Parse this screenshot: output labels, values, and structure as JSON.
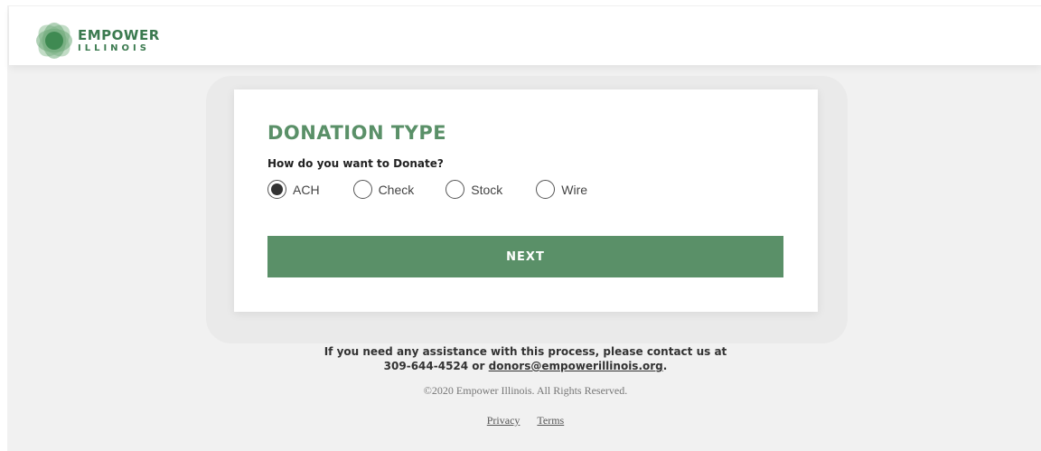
{
  "brand": {
    "logo_line1": "EMPOWER",
    "logo_line2": "ILLINOIS",
    "logo_icon": "leaf-flower-icon",
    "primary_color": "#5a9068",
    "logo_color": "#3b7a4f"
  },
  "form": {
    "title": "DONATION TYPE",
    "question": "How do you want to Donate?",
    "options": [
      {
        "label": "ACH",
        "selected": true
      },
      {
        "label": "Check",
        "selected": false
      },
      {
        "label": "Stock",
        "selected": false
      },
      {
        "label": "Wire",
        "selected": false
      }
    ],
    "next_label": "NEXT"
  },
  "footer": {
    "assist_line1": "If you need any assistance with this process, please contact us at",
    "phone_prefix": "309-644-4524 or",
    "email": "donors@empowerillinois.org",
    "assist_suffix": ".",
    "copyright": "©2020 Empower Illinois. All Rights Reserved.",
    "privacy_label": "Privacy",
    "terms_label": "Terms"
  }
}
